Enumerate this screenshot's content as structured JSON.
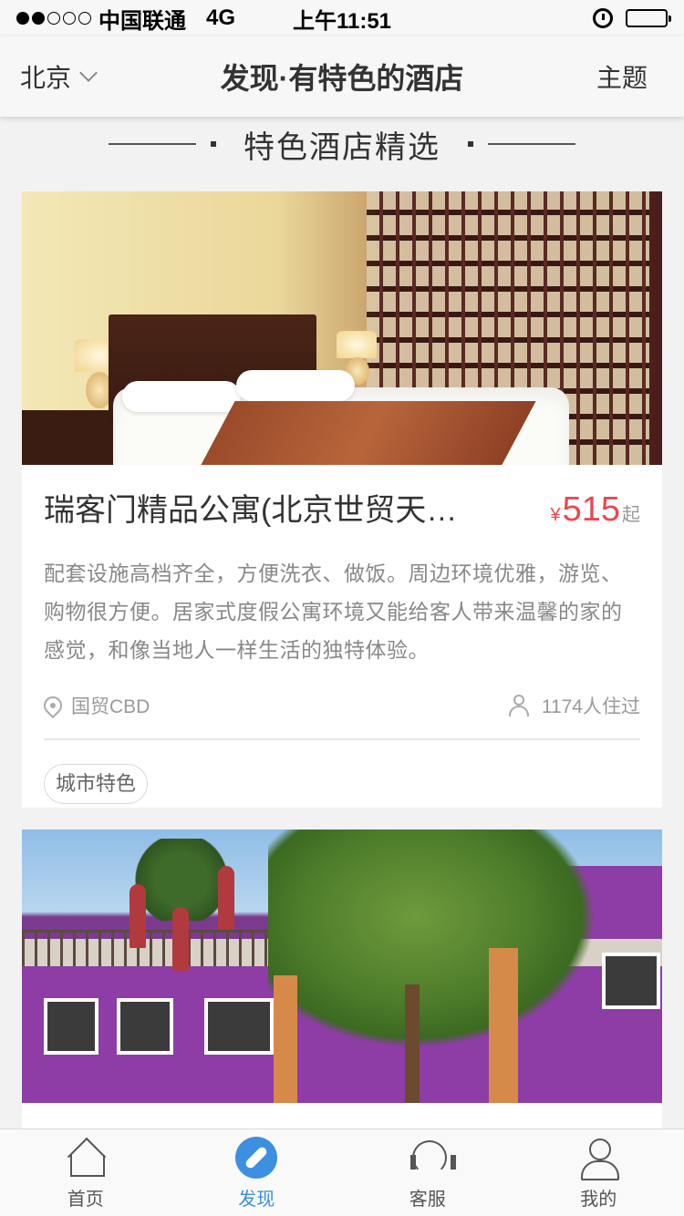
{
  "status_bar": {
    "carrier": "中国联通",
    "network": "4G",
    "time": "上午11:51",
    "battery_level": 0.4
  },
  "nav": {
    "city": "北京",
    "title": "发现·有特色的酒店",
    "right_action": "主题"
  },
  "section": {
    "title": "特色酒店精选"
  },
  "hotels": [
    {
      "name": "瑞客门精品公寓(北京世贸天…",
      "currency": "¥",
      "price": "515",
      "price_suffix": "起",
      "description": "配套设施高档齐全，方便洗衣、做饭。周边环境优雅，游览、购物很方便。居家式度假公寓环境又能给客人带来温馨的家的感觉，和像当地人一样生活的独特体验。",
      "location": "国贸CBD",
      "guests": "1174人住过",
      "tag": "城市特色"
    }
  ],
  "tabs": [
    {
      "label": "首页",
      "icon": "home-icon",
      "active": false
    },
    {
      "label": "发现",
      "icon": "compass-icon",
      "active": true
    },
    {
      "label": "客服",
      "icon": "headset-icon",
      "active": false
    },
    {
      "label": "我的",
      "icon": "user-icon",
      "active": false
    }
  ],
  "colors": {
    "accent": "#3d8fe0",
    "price": "#e8494e"
  }
}
